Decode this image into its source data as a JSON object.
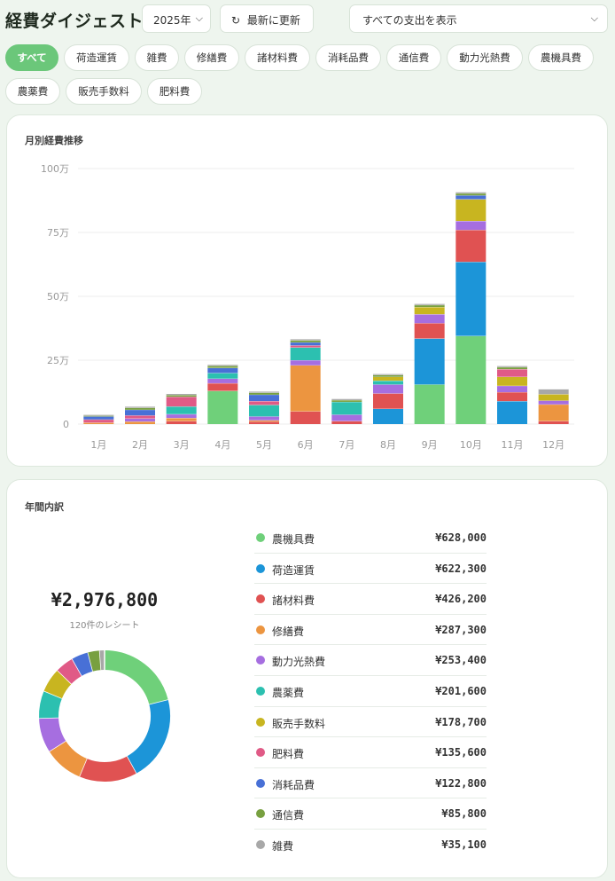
{
  "header": {
    "title": "経費ダイジェスト",
    "year_value": "2025年",
    "refresh_label": "最新に更新",
    "filter_value": "すべての支出を表示"
  },
  "chips": [
    {
      "label": "すべて",
      "active": true
    },
    {
      "label": "荷造運賃"
    },
    {
      "label": "雑費"
    },
    {
      "label": "修繕費"
    },
    {
      "label": "諸材料費"
    },
    {
      "label": "消耗品費"
    },
    {
      "label": "通信費"
    },
    {
      "label": "動力光熱費"
    },
    {
      "label": "農機具費"
    },
    {
      "label": "農薬費"
    },
    {
      "label": "販売手数料"
    },
    {
      "label": "肥料費"
    }
  ],
  "monthly_chart": {
    "title": "月別経費推移"
  },
  "chart_data": {
    "type": "bar",
    "stacked": true,
    "categories": [
      "1月",
      "2月",
      "3月",
      "4月",
      "5月",
      "6月",
      "7月",
      "8月",
      "9月",
      "10月",
      "11月",
      "12月"
    ],
    "ylim": [
      0,
      1000000
    ],
    "yticks": [
      {
        "v": 0,
        "label": "0"
      },
      {
        "v": 250000,
        "label": "25万"
      },
      {
        "v": 500000,
        "label": "50万"
      },
      {
        "v": 750000,
        "label": "75万"
      },
      {
        "v": 1000000,
        "label": "100万"
      }
    ],
    "grid": true,
    "series": [
      {
        "name": "農機具費",
        "color": "#6fd07a",
        "values": [
          0,
          0,
          0,
          130000,
          0,
          0,
          0,
          0,
          155000,
          345000,
          0,
          0
        ]
      },
      {
        "name": "荷造運賃",
        "color": "#1c95d8",
        "values": [
          0,
          0,
          0,
          0,
          0,
          0,
          0,
          60000,
          180000,
          290000,
          90000,
          0
        ]
      },
      {
        "name": "諸材料費",
        "color": "#e05252",
        "values": [
          0,
          0,
          12000,
          30000,
          10000,
          50000,
          12000,
          60000,
          60000,
          125000,
          35000,
          12000
        ]
      },
      {
        "name": "修繕費",
        "color": "#ec9540",
        "values": [
          6000,
          10000,
          12000,
          0,
          5000,
          180000,
          0,
          0,
          0,
          0,
          0,
          65000
        ]
      },
      {
        "name": "動力光熱費",
        "color": "#a66ee0",
        "values": [
          0,
          12000,
          15000,
          18000,
          15000,
          20000,
          25000,
          35000,
          35000,
          35000,
          25000,
          15000
        ]
      },
      {
        "name": "農薬費",
        "color": "#2cc0b0",
        "values": [
          0,
          0,
          30000,
          22000,
          45000,
          50000,
          50000,
          15000,
          0,
          0,
          0,
          0
        ]
      },
      {
        "name": "販売手数料",
        "color": "#c8b520",
        "values": [
          0,
          0,
          0,
          0,
          0,
          0,
          0,
          15000,
          28000,
          85000,
          35000,
          25000
        ]
      },
      {
        "name": "肥料費",
        "color": "#e05a86",
        "values": [
          12000,
          12000,
          38000,
          0,
          15000,
          8000,
          0,
          0,
          0,
          0,
          30000,
          0
        ]
      },
      {
        "name": "消耗品費",
        "color": "#4870d6",
        "values": [
          12000,
          22000,
          0,
          20000,
          25000,
          12000,
          0,
          0,
          0,
          15000,
          0,
          0
        ]
      },
      {
        "name": "通信費",
        "color": "#78a040",
        "values": [
          3000,
          8000,
          7000,
          8000,
          8000,
          8000,
          7000,
          7000,
          8000,
          8000,
          8000,
          0
        ]
      },
      {
        "name": "雑費",
        "color": "#a8a8a8",
        "values": [
          4000,
          5000,
          5000,
          5000,
          5000,
          5000,
          5000,
          5000,
          5000,
          5000,
          5000,
          20000
        ]
      }
    ]
  },
  "breakdown": {
    "title": "年間内訳",
    "total": "¥2,976,800",
    "receipt_count": "120件のレシート",
    "items": [
      {
        "name": "農機具費",
        "value": "¥628,000",
        "amount": 628000,
        "color": "#6fd07a"
      },
      {
        "name": "荷造運賃",
        "value": "¥622,300",
        "amount": 622300,
        "color": "#1c95d8"
      },
      {
        "name": "諸材料費",
        "value": "¥426,200",
        "amount": 426200,
        "color": "#e05252"
      },
      {
        "name": "修繕費",
        "value": "¥287,300",
        "amount": 287300,
        "color": "#ec9540"
      },
      {
        "name": "動力光熱費",
        "value": "¥253,400",
        "amount": 253400,
        "color": "#a66ee0"
      },
      {
        "name": "農薬費",
        "value": "¥201,600",
        "amount": 201600,
        "color": "#2cc0b0"
      },
      {
        "name": "販売手数料",
        "value": "¥178,700",
        "amount": 178700,
        "color": "#c8b520"
      },
      {
        "name": "肥料費",
        "value": "¥135,600",
        "amount": 135600,
        "color": "#e05a86"
      },
      {
        "name": "消耗品費",
        "value": "¥122,800",
        "amount": 122800,
        "color": "#4870d6"
      },
      {
        "name": "通信費",
        "value": "¥85,800",
        "amount": 85800,
        "color": "#78a040"
      },
      {
        "name": "雑費",
        "value": "¥35,100",
        "amount": 35100,
        "color": "#a8a8a8"
      }
    ]
  },
  "icons": {
    "refresh": "refresh-icon",
    "dropdown": "chevron-down-icon"
  }
}
